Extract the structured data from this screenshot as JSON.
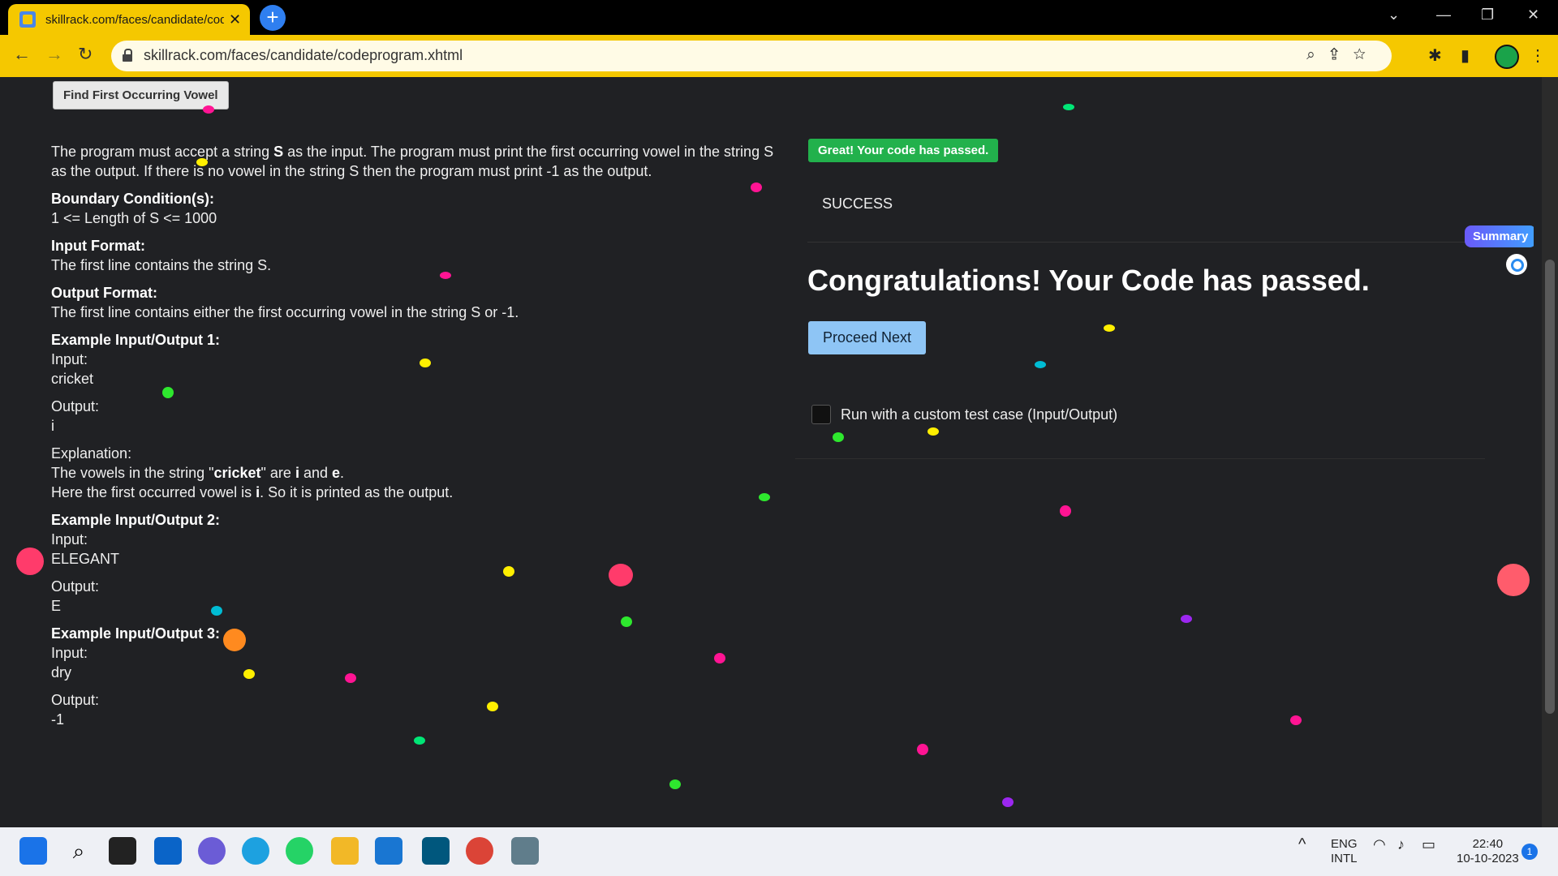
{
  "browser": {
    "tab_title": "skillrack.com/faces/candidate/codeprogram.xhtml",
    "tab_close": "✕",
    "new_tab": "+",
    "url": "skillrack.com/faces/candidate/codeprogram.xhtml",
    "window_controls": [
      "⌄",
      "—",
      "❐",
      "✕"
    ]
  },
  "problem": {
    "button_label": "Find First Occurring Vowel",
    "description_1": "The program must accept a string ",
    "description_bold": "S",
    "description_2": " as the input. The program must print the first occurring vowel in the string S as the output. If there is no vowel in the string S then the program must print -1 as the output.",
    "boundary_heading": "Boundary Condition(s):",
    "boundary_text": "1 <= Length of S <= 1000",
    "input_heading": "Input Format:",
    "input_text": "The first line contains the string S.",
    "output_heading": "Output Format:",
    "output_text": "The first line contains either the first occurring vowel in the string S or -1.",
    "examples": [
      {
        "heading": "Example Input/Output 1:",
        "input_label": "Input:",
        "input": "cricket",
        "output_label": "Output:",
        "output": "i"
      },
      {
        "heading": "Example Input/Output 2:",
        "input_label": "Input:",
        "input": "ELEGANT",
        "output_label": "Output:",
        "output": "E"
      },
      {
        "heading": "Example Input/Output 3:",
        "input_label": "Input:",
        "input": "dry",
        "output_label": "Output:",
        "output": "-1"
      }
    ],
    "explanation_label": "Explanation:",
    "explanation_1a": "The vowels in the string \"",
    "explanation_word": "cricket",
    "explanation_1b": "\" are ",
    "explanation_v1": "i",
    "explanation_and": " and ",
    "explanation_v2": "e",
    "explanation_dot": ".",
    "explanation_2a": "Here the first occurred vowel is ",
    "explanation_2b": "i",
    "explanation_2c": ". So it is printed as the output."
  },
  "result": {
    "badge": "Great! Your code has passed.",
    "status": "SUCCESS",
    "congrats": "Congratulations! Your Code has passed.",
    "proceed": "Proceed Next",
    "custom_label": "Run with a custom test case (Input/Output)",
    "summary": "Summary"
  },
  "taskbar": {
    "lang_1": "ENG",
    "lang_2": "INTL",
    "time": "22:40",
    "date": "10-10-2023",
    "notif": "1"
  }
}
